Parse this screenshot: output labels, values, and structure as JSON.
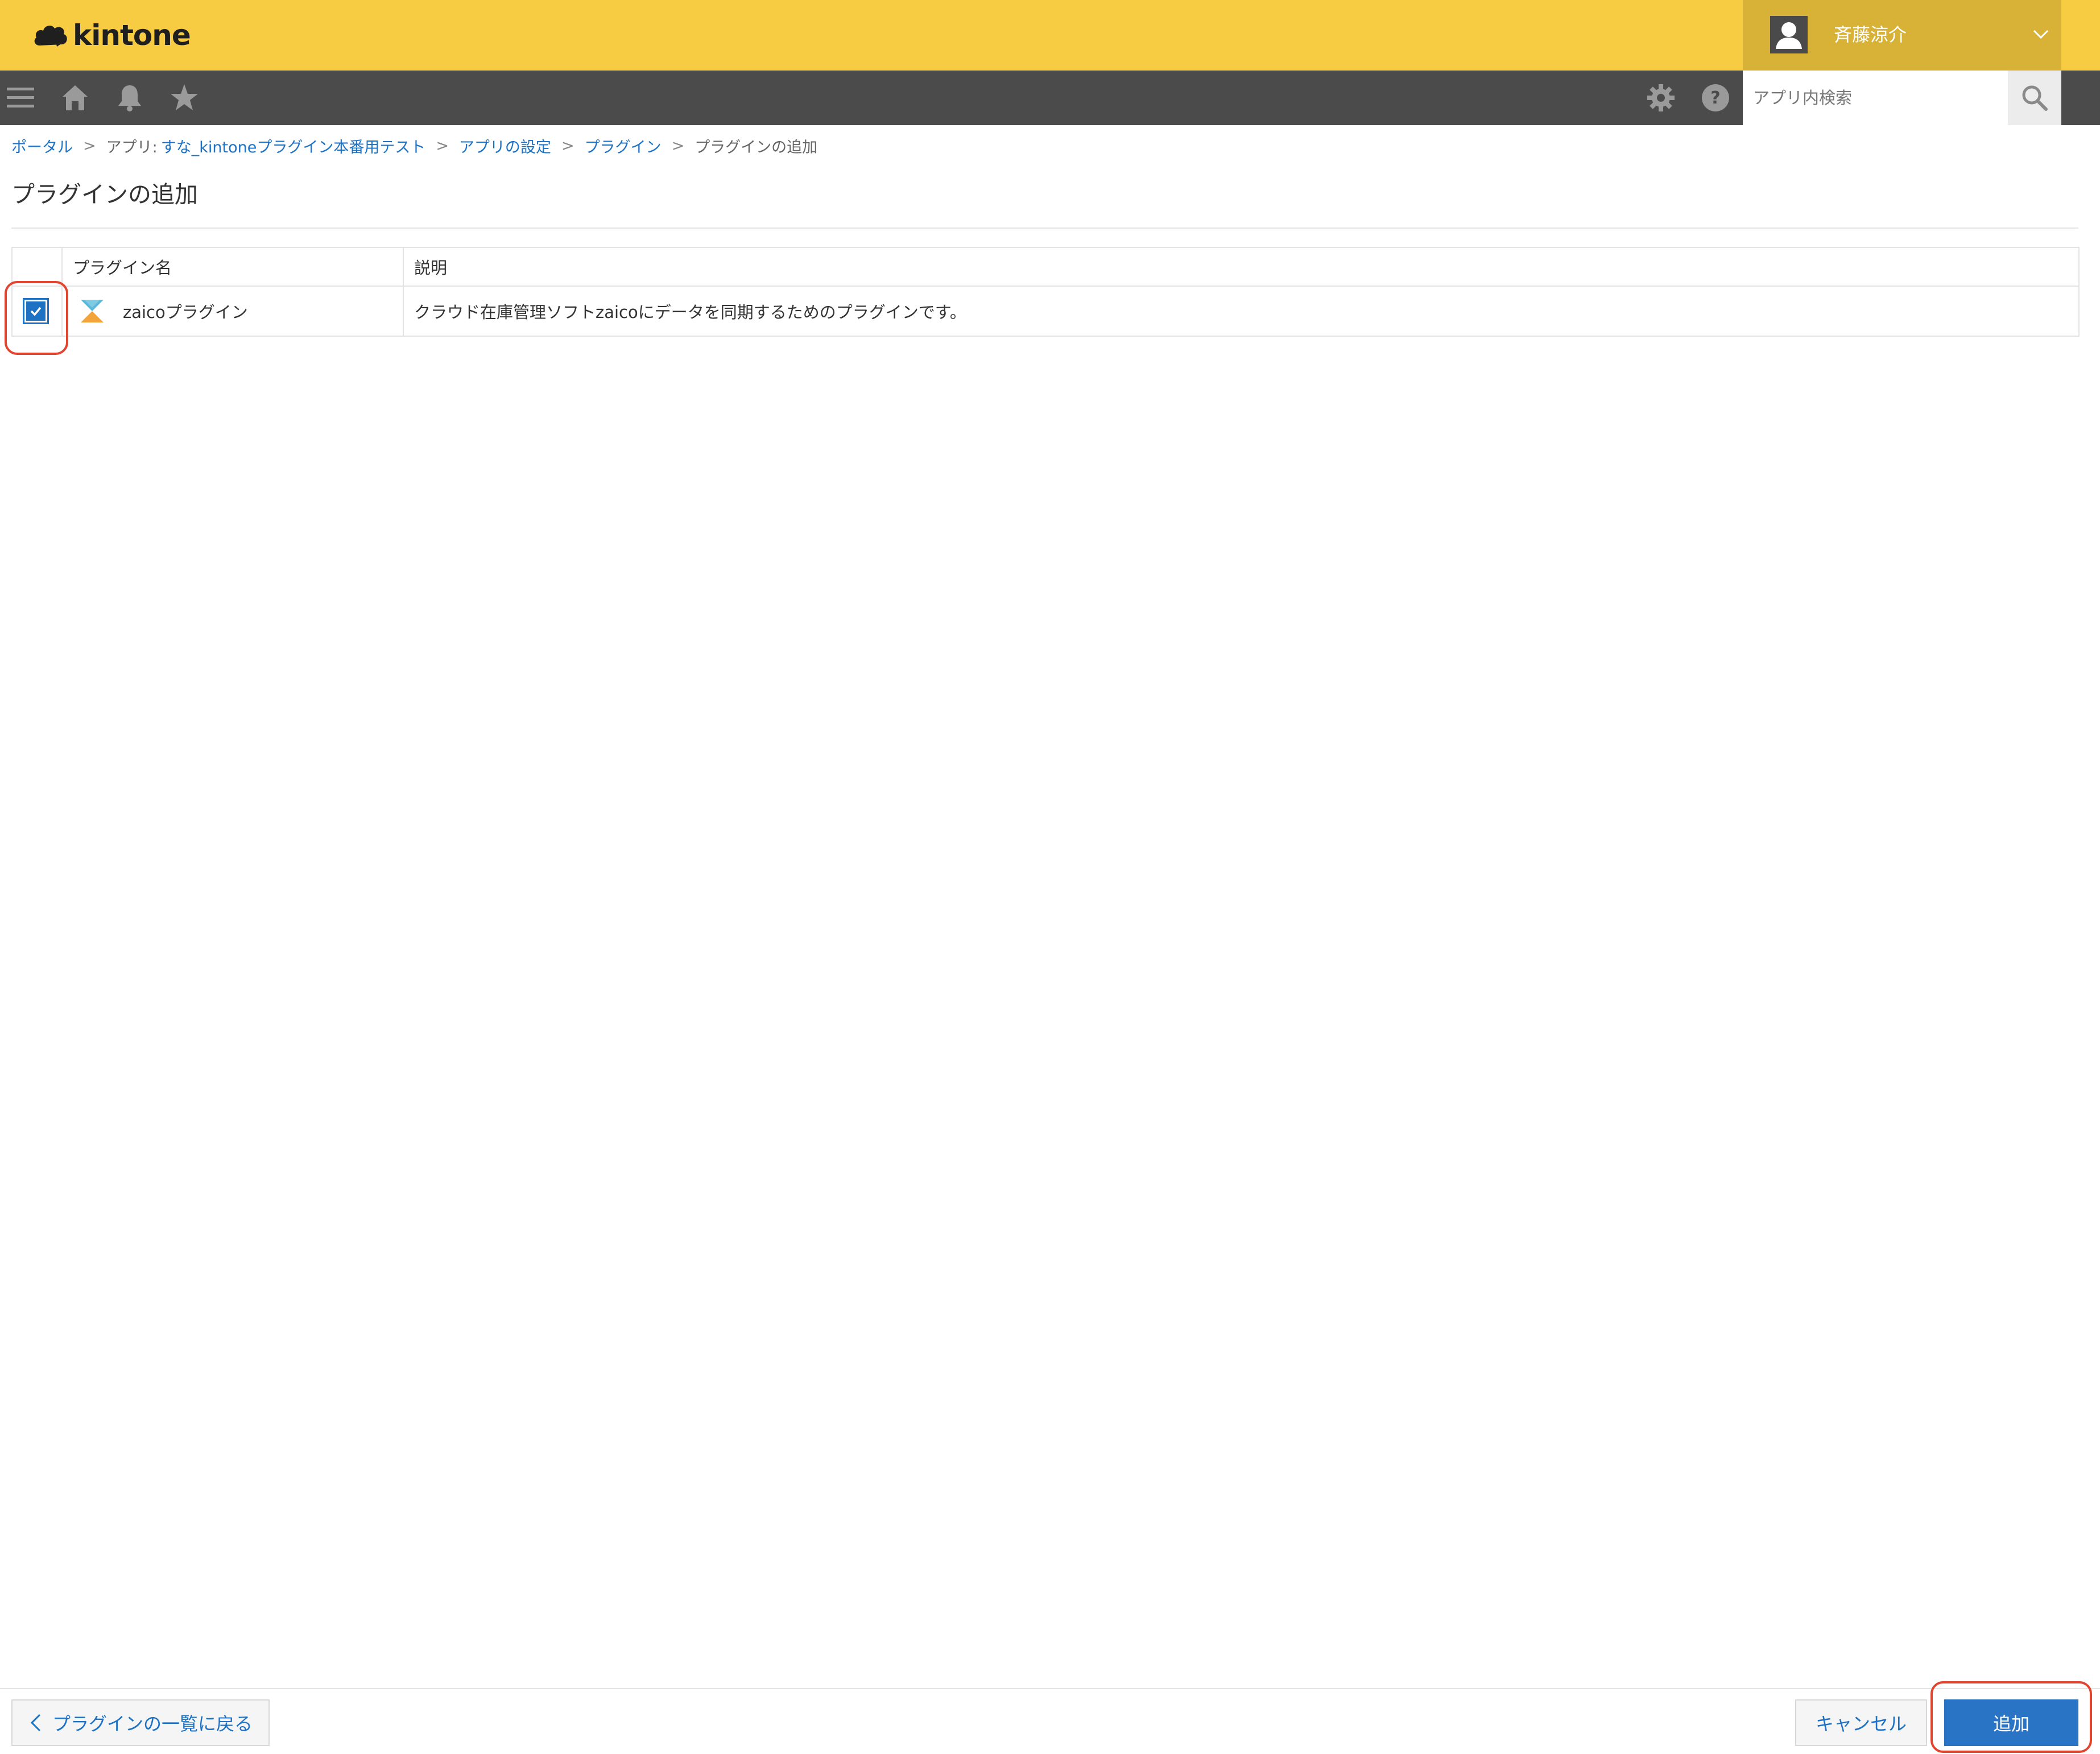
{
  "app": {
    "logo_text": "kintone"
  },
  "user": {
    "name": "斉藤涼介"
  },
  "toolbar": {
    "icons": [
      "menu-icon",
      "home-icon",
      "bell-icon",
      "star-icon",
      "gear-icon",
      "help-icon",
      "search-icon"
    ],
    "search_placeholder": "アプリ内検索"
  },
  "breadcrumb": {
    "portal": "ポータル",
    "app_prefix": "アプリ:",
    "app_name": "すな_kintoneプラグイン本番用テスト",
    "settings": "アプリの設定",
    "plugin": "プラグイン",
    "current": "プラグインの追加",
    "separator": ">"
  },
  "page": {
    "title": "プラグインの追加"
  },
  "table": {
    "headers": {
      "name": "プラグイン名",
      "description": "説明"
    },
    "rows": [
      {
        "checked": true,
        "name": "zaicoプラグイン",
        "description": "クラウド在庫管理ソフトzaicoにデータを同期するためのプラグインです。"
      }
    ]
  },
  "footer": {
    "back_label": "プラグインの一覧に戻る",
    "cancel_label": "キャンセル",
    "add_label": "追加"
  },
  "colors": {
    "header_yellow": "#f8cc42",
    "user_box": "#d7b236",
    "toolbar": "#4b4b4b",
    "link_blue": "#1d72c4",
    "primary_button": "#2a74c6",
    "highlight_red": "#e2452f"
  }
}
